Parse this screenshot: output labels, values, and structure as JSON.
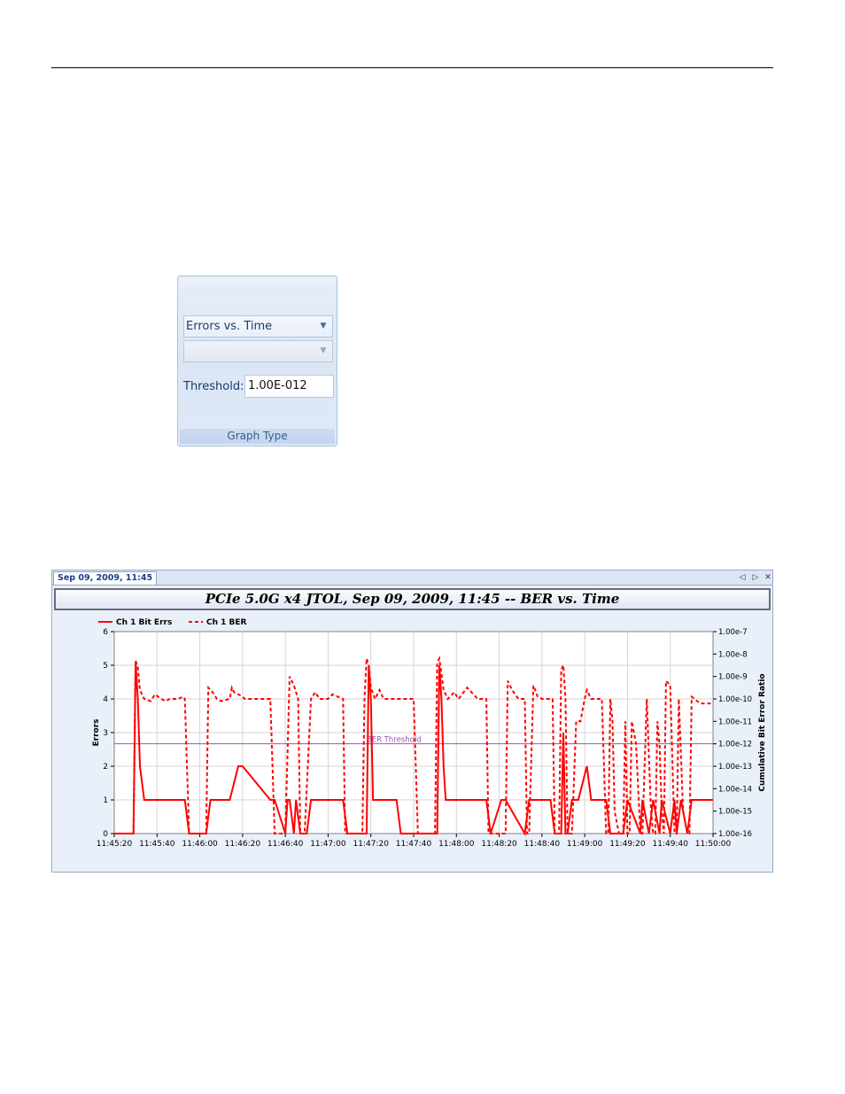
{
  "graph_type_panel": {
    "graph_type_value": "Errors vs. Time",
    "secondary_value": "",
    "threshold_label": "Threshold:",
    "threshold_value": "1.00E-012",
    "group_label": "Graph Type"
  },
  "chart_window": {
    "tab_label": "Sep 09, 2009, 11:45",
    "title": "PCIe 5.0G x4 JTOL, Sep 09, 2009, 11:45 -- BER vs. Time",
    "icons": [
      "tab-left-icon",
      "tab-right-icon",
      "close-icon"
    ]
  },
  "chart_data": {
    "type": "line",
    "title": "PCIe 5.0G x4 JTOL, Sep 09, 2009, 11:45 -- BER vs. Time",
    "xlabel": "",
    "ylabel": "Errors",
    "y2label": "Cumulative Bit Error Ratio",
    "x_ticks": [
      "11:45:20",
      "11:45:40",
      "11:46:00",
      "11:46:20",
      "11:46:40",
      "11:47:00",
      "11:47:20",
      "11:47:40",
      "11:48:00",
      "11:48:20",
      "11:48:40",
      "11:49:00",
      "11:49:20",
      "11:49:40",
      "11:50:00"
    ],
    "xlim_seconds": [
      0,
      280
    ],
    "ylim": [
      0,
      6
    ],
    "y_ticks": [
      "0",
      "1",
      "2",
      "3",
      "4",
      "5",
      "6"
    ],
    "y2_log_exponent_range": [
      -16,
      -7
    ],
    "y2_ticks": [
      "1.00e-16",
      "1.00e-15",
      "1.00e-14",
      "1.00e-13",
      "1.00e-12",
      "1.00e-11",
      "1.00e-10",
      "1.00e-9",
      "1.00e-8",
      "1.00e-7"
    ],
    "grid": true,
    "legend_position": "top-left",
    "threshold": {
      "label": "BER Threshold",
      "value": "1.00e-12",
      "color": "#9a52b8"
    },
    "series": [
      {
        "name": "Ch 1 Bit Errs",
        "axis": "left",
        "style": "solid",
        "color": "#ff0000",
        "x": [
          0,
          9,
          10,
          11,
          12,
          14,
          33,
          35,
          43,
          45,
          54,
          56,
          58,
          60,
          73,
          75,
          80,
          81,
          82,
          84,
          85,
          87,
          90,
          92,
          107,
          109,
          118,
          119,
          120,
          121,
          132,
          134,
          151,
          152,
          153,
          154,
          155,
          157,
          174,
          176,
          181,
          183,
          192,
          194,
          204,
          206,
          209,
          210,
          211,
          212,
          214,
          217,
          221,
          223,
          230,
          232,
          238,
          240,
          246,
          247,
          250,
          252,
          255,
          256,
          260,
          262,
          263,
          265,
          268,
          270,
          280
        ],
        "y": [
          0,
          0,
          5.1,
          4,
          2,
          1,
          1,
          0,
          0,
          1,
          1,
          1.5,
          2,
          2,
          1,
          1,
          0,
          1,
          1,
          0,
          1,
          0,
          0,
          1,
          1,
          0,
          0,
          5,
          4,
          1,
          1,
          0,
          0,
          5,
          4,
          2,
          1,
          1,
          1,
          0,
          1,
          1,
          0,
          1,
          1,
          0,
          0,
          3,
          0,
          0,
          1,
          1,
          2,
          1,
          1,
          0,
          0,
          1,
          0,
          1,
          0,
          1,
          0,
          1,
          0,
          1,
          0,
          1,
          0,
          1,
          1
        ]
      },
      {
        "name": "Ch 1 BER",
        "axis": "right",
        "style": "dashed",
        "color": "#ff0000",
        "x": [
          0,
          9,
          10,
          11,
          12,
          14,
          17,
          19,
          22,
          24,
          26,
          30,
          32,
          33,
          35,
          43,
          44,
          46,
          48,
          50,
          54,
          55,
          56,
          58,
          60,
          61,
          64,
          73,
          75,
          80,
          82,
          84,
          86,
          87,
          89,
          92,
          94,
          96,
          100,
          102,
          107,
          108,
          116,
          117,
          118,
          119,
          120,
          122,
          124,
          126,
          130,
          132,
          134,
          140,
          142,
          150,
          151,
          152,
          153,
          154,
          156,
          159,
          161,
          165,
          170,
          174,
          175,
          183,
          184,
          186,
          189,
          192,
          193,
          194,
          196,
          198,
          200,
          204,
          205,
          206,
          208,
          209,
          210,
          211,
          212,
          214,
          216,
          218,
          220,
          221,
          223,
          226,
          228,
          230,
          231,
          232,
          233,
          234,
          236,
          238,
          239,
          240,
          241,
          242,
          244,
          246,
          247,
          249,
          251,
          252,
          253,
          254,
          255,
          256,
          257,
          258,
          260,
          262,
          263,
          264,
          266,
          268,
          269,
          270,
          274,
          280
        ],
        "ber_exp": [
          -16,
          -16,
          -8.3,
          -8.6,
          -9.6,
          -10,
          -10.1,
          -9.8,
          -10,
          -10.1,
          -10,
          -10,
          -9.9,
          -10,
          -16,
          -16,
          -9.5,
          -9.7,
          -10,
          -10.1,
          -10,
          -9.5,
          -9.7,
          -9.8,
          -9.9,
          -10,
          -10,
          -10,
          -16,
          -16,
          -9,
          -9.4,
          -10,
          -16,
          -16,
          -10,
          -9.7,
          -10,
          -10,
          -9.8,
          -10,
          -16,
          -16,
          -10,
          -8.2,
          -8.5,
          -9.5,
          -10,
          -9.6,
          -10,
          -10,
          -10,
          -10,
          -10,
          -16,
          -16,
          -8.4,
          -8.2,
          -8.9,
          -9.6,
          -10,
          -9.7,
          -10,
          -9.5,
          -10,
          -10,
          -16,
          -16,
          -9.2,
          -9.6,
          -10,
          -10,
          -16,
          -16,
          -9.4,
          -9.9,
          -10,
          -10,
          -10,
          -16,
          -16,
          -8.7,
          -8.5,
          -10,
          -16,
          -16,
          -11,
          -11,
          -10,
          -9.6,
          -10,
          -10,
          -10,
          -16,
          -16,
          -10,
          -11,
          -15,
          -16,
          -16,
          -11,
          -16,
          -16,
          -11,
          -12,
          -16,
          -16,
          -10,
          -15,
          -16,
          -16,
          -11,
          -12,
          -15,
          -16,
          -9.2,
          -9.4,
          -16,
          -16,
          -10,
          -15,
          -16,
          -16,
          -9.9,
          -10.2,
          -10.2,
          -10.2
        ]
      }
    ]
  }
}
